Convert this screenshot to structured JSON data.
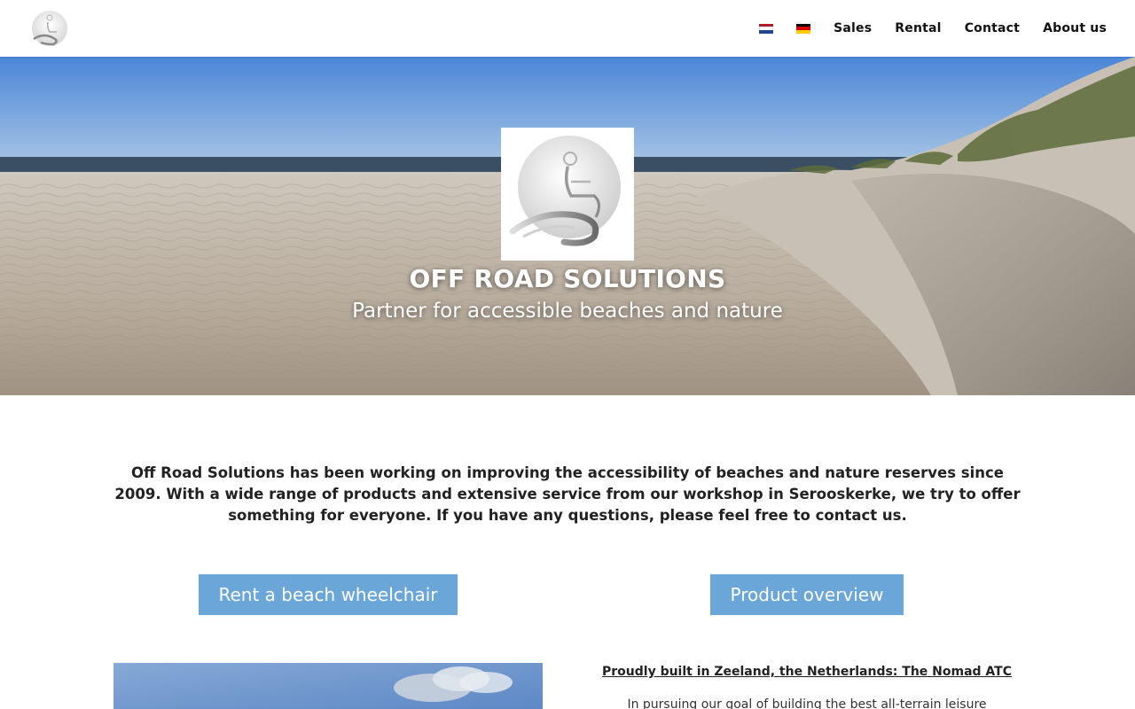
{
  "header": {
    "logo_icon": "wheelchair-logo-icon",
    "flags": [
      {
        "name": "dutch-flag-icon",
        "colors": [
          "#ae1c28",
          "#ffffff",
          "#21468b"
        ]
      },
      {
        "name": "german-flag-icon",
        "colors": [
          "#000000",
          "#dd0000",
          "#ffce00"
        ]
      }
    ],
    "nav": [
      {
        "label": "Sales"
      },
      {
        "label": "Rental"
      },
      {
        "label": "Contact"
      },
      {
        "label": "About us"
      }
    ]
  },
  "hero": {
    "title": "OFF ROAD SOLUTIONS",
    "subtitle": "Partner for accessible beaches and nature",
    "logo_icon": "wheelchair-logo-icon"
  },
  "intro": {
    "text": "Off Road Solutions has been working on improving the accessibility of beaches and nature reserves since 2009. With a wide range of products and extensive service from our workshop in Serooskerke, we try to offer something for everyone. If you have any questions, please feel free to contact us."
  },
  "buttons": {
    "rent": "Rent a beach wheelchair",
    "products": "Product overview"
  },
  "feature": {
    "heading": "Proudly built in Zeeland, the Netherlands: The Nomad ATC",
    "text": "In pursuing our goal of building the best all-terrain leisure"
  },
  "colors": {
    "accent": "#6aa6d8",
    "text": "#222222"
  }
}
